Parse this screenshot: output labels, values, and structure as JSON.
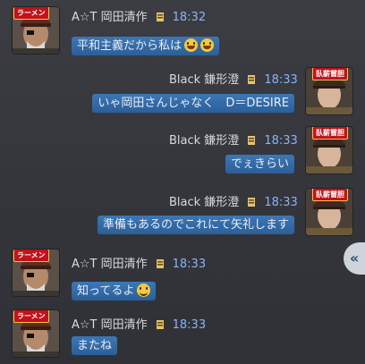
{
  "messages": [
    {
      "side": "left",
      "badge": "ラーメン",
      "name": "A☆T 岡田清作",
      "time": "18:32",
      "text": "平和主義だから私は",
      "emoji": [
        "laugh",
        "laugh"
      ]
    },
    {
      "side": "right",
      "badge": "臥薪嘗胆",
      "name": "Black 鎌形澄",
      "time": "18:33",
      "text": "いゃ岡田さんじゃなく　D＝DESIRE",
      "emoji": []
    },
    {
      "side": "right",
      "badge": "臥薪嘗胆",
      "name": "Black 鎌形澄",
      "time": "18:33",
      "text": "でぇきらい",
      "emoji": []
    },
    {
      "side": "right",
      "badge": "臥薪嘗胆",
      "name": "Black 鎌形澄",
      "time": "18:33",
      "text": "準備もあるのでこれにて矢礼します",
      "emoji": []
    },
    {
      "side": "left",
      "badge": "ラーメン",
      "name": "A☆T 岡田清作",
      "time": "18:33",
      "text": "知ってるよ",
      "emoji": [
        "smile"
      ]
    },
    {
      "side": "left",
      "badge": "ラーメン",
      "name": "A☆T 岡田清作",
      "time": "18:33",
      "text": "またね",
      "emoji": []
    }
  ],
  "collapse": {
    "label": "«"
  },
  "colors": {
    "bubble": "#2f6aa8",
    "time": "#8ab4f8",
    "badge": "#c2121a"
  },
  "icons": {
    "rank": "rank-insignia-icon",
    "collapse": "chevron-double-left-icon"
  }
}
